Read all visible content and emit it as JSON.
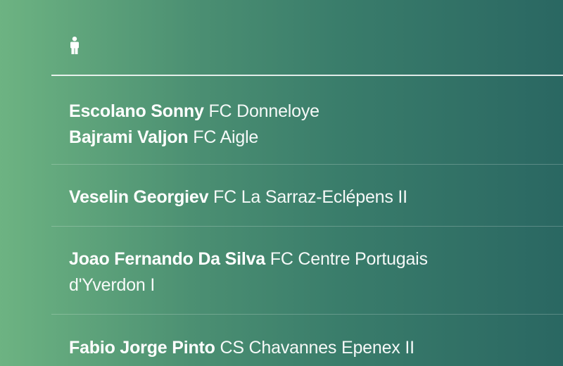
{
  "header": {
    "icon": "person-icon"
  },
  "entries": [
    {
      "players": [
        {
          "name": "Escolano Sonny",
          "club": "FC Donneloye"
        },
        {
          "name": "Bajrami Valjon",
          "club": "FC Aigle"
        }
      ]
    },
    {
      "players": [
        {
          "name": "Veselin Georgiev",
          "club": "FC La Sarraz-Eclépens II"
        }
      ]
    },
    {
      "players": [
        {
          "name": "Joao Fernando Da Silva",
          "club": "FC Centre Portugais d'Yverdon I"
        }
      ]
    },
    {
      "players": [
        {
          "name": "Fabio Jorge Pinto",
          "club": "CS Chavannes Epenex II"
        }
      ]
    }
  ]
}
